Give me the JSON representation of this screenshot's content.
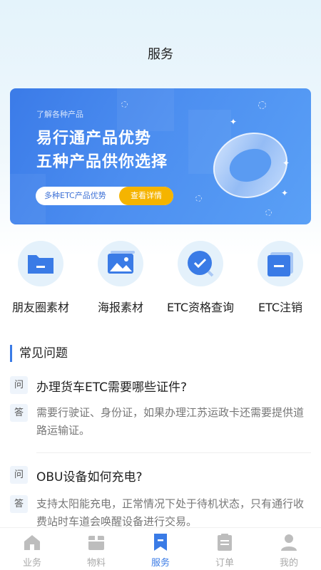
{
  "header": {
    "title": "服务"
  },
  "banner": {
    "subtitle": "了解各种产品",
    "title_line1": "易行通产品优势",
    "title_line2": "五种产品供你选择",
    "pill_text": "多种ETC产品优势",
    "pill_button": "查看详情",
    "accent_color": "#3b7be8",
    "button_color": "#f5b400"
  },
  "quick_actions": [
    {
      "label": "朋友圈素材",
      "icon": "folder-icon"
    },
    {
      "label": "海报素材",
      "icon": "image-icon"
    },
    {
      "label": "ETC资格查询",
      "icon": "check-search-icon"
    },
    {
      "label": "ETC注销",
      "icon": "card-minus-icon"
    }
  ],
  "faq": {
    "title": "常见问题",
    "q_tag": "问",
    "a_tag": "答",
    "items": [
      {
        "question": "办理货车ETC需要哪些证件?",
        "answer": "需要行驶证、身份证，如果办理江苏运政卡还需要提供道路运输证。"
      },
      {
        "question": "OBU设备如何充电?",
        "answer": "支持太阳能充电，正常情况下处于待机状态，只有通行收费站时车道会唤醒设备进行交易。"
      }
    ]
  },
  "tabbar": {
    "items": [
      {
        "label": "业务",
        "icon": "home-icon",
        "active": false
      },
      {
        "label": "物料",
        "icon": "box-icon",
        "active": false
      },
      {
        "label": "服务",
        "icon": "bookmark-icon",
        "active": true
      },
      {
        "label": "订单",
        "icon": "clipboard-icon",
        "active": false
      },
      {
        "label": "我的",
        "icon": "user-icon",
        "active": false
      }
    ],
    "active_color": "#3a7be6",
    "inactive_color": "#aaaaaa"
  }
}
